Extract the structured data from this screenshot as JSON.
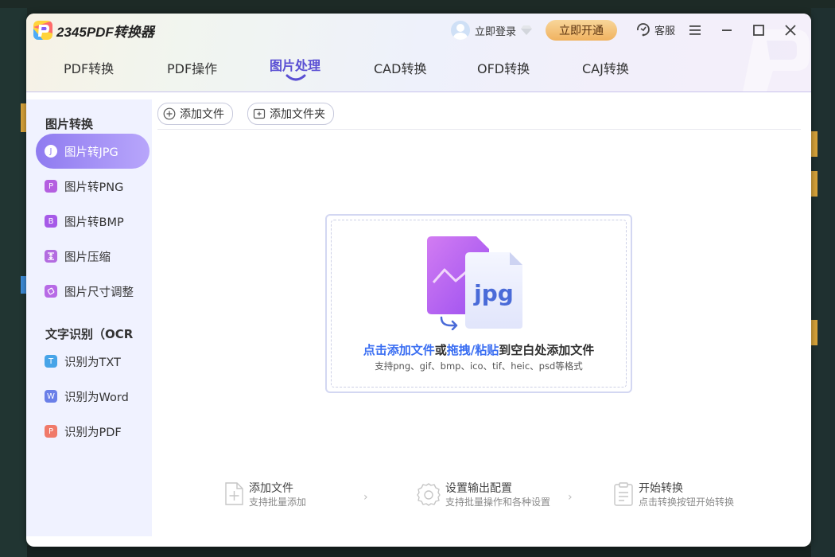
{
  "app": {
    "title": "2345PDF转换器"
  },
  "header": {
    "login_label": "立即登录",
    "vip_label": "立即开通",
    "service_label": "客服"
  },
  "tabs": [
    {
      "label": "PDF转换",
      "active": false
    },
    {
      "label": "PDF操作",
      "active": false
    },
    {
      "label": "图片处理",
      "active": true
    },
    {
      "label": "CAD转换",
      "active": false
    },
    {
      "label": "OFD转换",
      "active": false
    },
    {
      "label": "CAJ转换",
      "active": false
    }
  ],
  "sidebar": {
    "section1_title": "图片转换",
    "section2_title": "文字识别（OCR",
    "items": [
      {
        "label": "图片转JPG",
        "icon": "J",
        "active": true
      },
      {
        "label": "图片转PNG",
        "icon": "P",
        "active": false
      },
      {
        "label": "图片转BMP",
        "icon": "B",
        "active": false
      },
      {
        "label": "图片压缩",
        "icon": "compress",
        "active": false
      },
      {
        "label": "图片尺寸调整",
        "icon": "resize",
        "active": false
      },
      {
        "label": "识别为TXT",
        "icon": "T",
        "active": false
      },
      {
        "label": "识别为Word",
        "icon": "W",
        "active": false
      },
      {
        "label": "识别为PDF",
        "icon": "P",
        "active": false
      }
    ]
  },
  "toolbar": {
    "add_file": "添加文件",
    "add_folder": "添加文件夹"
  },
  "dropzone": {
    "part1": "点击添加文件",
    "part2": "或",
    "part3": "拖拽/粘贴",
    "part4": "到空白处添加文件",
    "formats": "支持png、gif、bmp、ico、tif、heic、psd等格式",
    "badge": "jpg"
  },
  "steps": [
    {
      "title": "添加文件",
      "subtitle": "支持批量添加"
    },
    {
      "title": "设置输出配置",
      "subtitle": "支持批量操作和各种设置"
    },
    {
      "title": "开始转换",
      "subtitle": "点击转换按钮开始转换"
    }
  ],
  "colors": {
    "accent": "#5a4fd3",
    "link_blue": "#3a6ef2",
    "vip_orange": "#f0b25f",
    "sidebar_bg": "#f0f2ff"
  }
}
